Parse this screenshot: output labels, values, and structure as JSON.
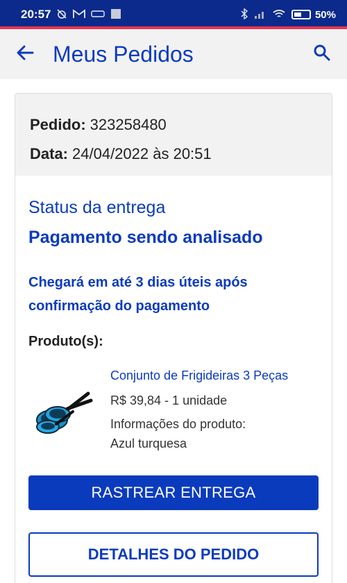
{
  "status_bar": {
    "time": "20:57",
    "battery_percent": "50%",
    "battery_level": 0.5,
    "left_icons": [
      "alarm-off-icon",
      "gmail-icon",
      "ifood-icon",
      "square-icon"
    ],
    "right_icons": [
      "bluetooth-icon",
      "signal-icon",
      "wifi-icon",
      "battery-icon"
    ]
  },
  "app_bar": {
    "title": "Meus Pedidos",
    "back_icon": "arrow-left-icon",
    "search_icon": "search-icon"
  },
  "order": {
    "number_label": "Pedido:",
    "number": "323258480",
    "date_label": "Data:",
    "date": "24/04/2022 às 20:51"
  },
  "delivery": {
    "status_label": "Status da entrega",
    "status_value": "Pagamento sendo analisado",
    "eta": "Chegará em até 3 dias úteis após confirmação do pagamento"
  },
  "products": {
    "title": "Produto(s):",
    "items": [
      {
        "name": "Conjunto de Frigideiras 3 Peças",
        "price_qty": "R$ 39,84 - 1 unidade",
        "info_label": "Informações do produto:",
        "info_value": "Azul turquesa",
        "image_icon": "frying-pans-icon"
      }
    ]
  },
  "actions": {
    "track_label": "RASTREAR ENTREGA",
    "details_label": "DETALHES DO PEDIDO"
  },
  "colors": {
    "primary": "#0b3bbd",
    "status_bar": "#0b2a8c",
    "accent": "#e8334d",
    "header_bg": "#f2f2f2"
  }
}
